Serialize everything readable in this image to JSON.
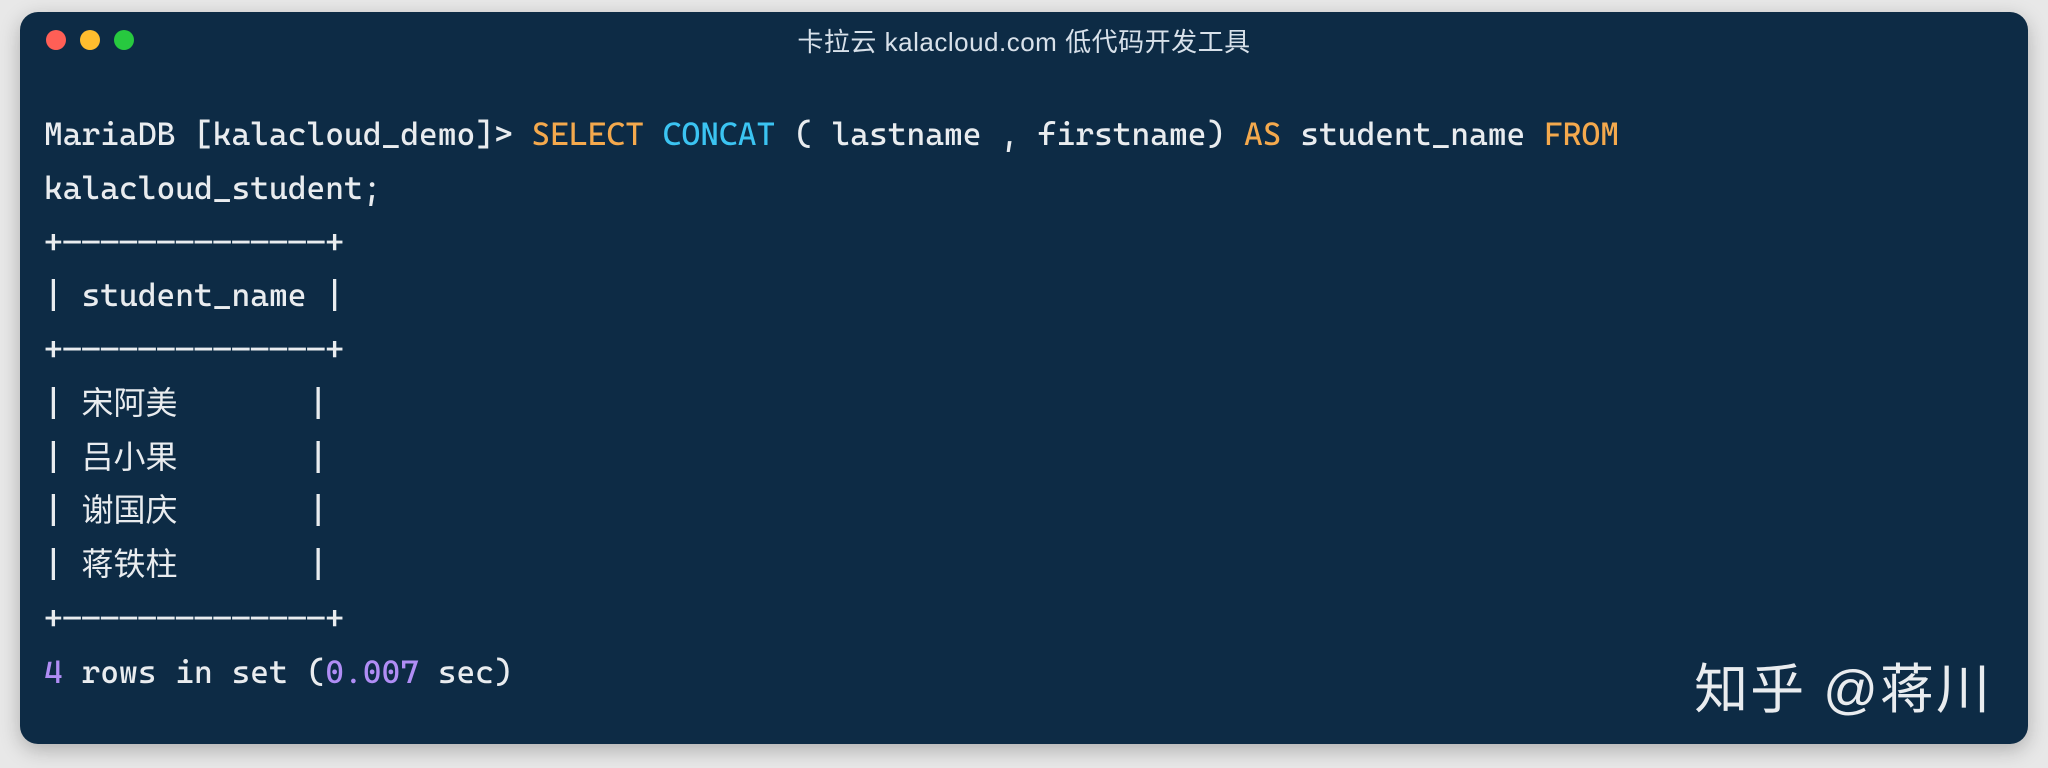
{
  "titlebar": {
    "title": "卡拉云 kalacloud.com 低代码开发工具"
  },
  "prompt": {
    "host": "MariaDB [kalacloud_demo]> ",
    "kw_select": "SELECT",
    "sp1": " ",
    "fn_concat": "CONCAT",
    "args": " ( lastname , firstname) ",
    "kw_as": "AS",
    "sp2": " ",
    "alias": "student_name",
    "sp3": " ",
    "kw_from": "FROM",
    "line2": "kalacloud_student;"
  },
  "border_top": "+——————————————+",
  "header_line": "| student_name |",
  "border_mid": "+——————————————+",
  "rows": [
    "| 宋阿美       |",
    "| 吕小果       |",
    "| 谢国庆       |",
    "| 蒋铁柱       |"
  ],
  "border_bot": "+——————————————+",
  "footer": {
    "count": "4",
    "mid": " rows in set (",
    "time": "0.007",
    "tail": " sec)"
  },
  "watermark": "知乎 @蒋川"
}
